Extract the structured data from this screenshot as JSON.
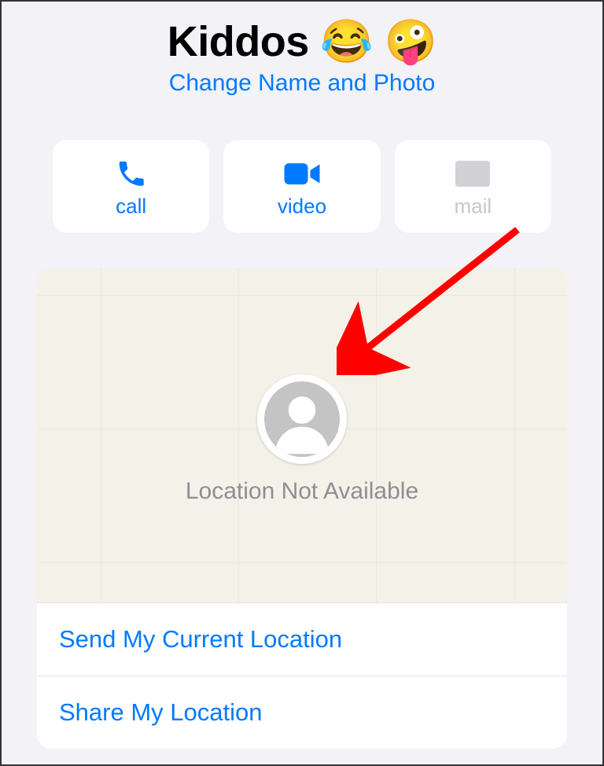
{
  "header": {
    "title": "Kiddos 😂 🤪",
    "subtitle": "Change Name and Photo"
  },
  "actions": {
    "call": "call",
    "video": "video",
    "mail": "mail"
  },
  "location": {
    "status_text": "Location Not Available",
    "send_current": "Send My Current Location",
    "share": "Share My Location"
  },
  "colors": {
    "accent": "#007aff",
    "disabled": "#c7c7cc",
    "map_bg": "#f4f1e8",
    "annotation_arrow": "#ff0000"
  }
}
